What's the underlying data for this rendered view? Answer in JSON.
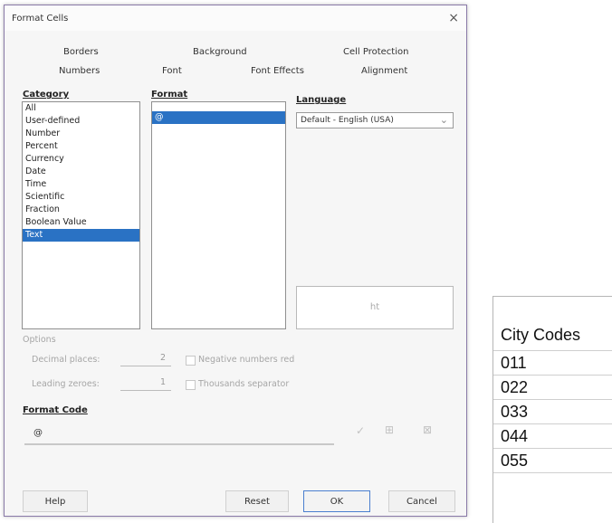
{
  "dialog": {
    "title": "Format Cells",
    "close_icon": "×",
    "tabs_top": [
      "Borders",
      "Background",
      "Cell Protection"
    ],
    "tabs_bottom": [
      "Numbers",
      "Font",
      "Font Effects",
      "Alignment"
    ],
    "category_label": "Category",
    "categories": [
      "All",
      "User-defined",
      "Number",
      "Percent",
      "Currency",
      "Date",
      "Time",
      "Scientific",
      "Fraction",
      "Boolean Value",
      "Text"
    ],
    "selected_category": "Text",
    "format_label": "Format",
    "formats": [
      "@"
    ],
    "selected_format": "@",
    "language_label": "Language",
    "language_value": "Default - English (USA)",
    "chevron_icon": "⌄",
    "preview_text": "ht",
    "options_label": "Options",
    "decimal_places_label": "Decimal places:",
    "decimal_places_value": "2",
    "leading_zeroes_label": "Leading zeroes:",
    "leading_zeroes_value": "1",
    "negative_red_label": "Negative numbers red",
    "thousands_sep_label": "Thousands separator",
    "format_code_label": "Format Code",
    "format_code_value": "@",
    "check_icon": "✓",
    "comment_icon": "⊞",
    "delete_icon": "⊠",
    "buttons": {
      "help": "Help",
      "reset": "Reset",
      "ok": "OK",
      "cancel": "Cancel"
    }
  },
  "sheet": {
    "header": "City Codes",
    "values": [
      "011",
      "022",
      "033",
      "044",
      "055"
    ]
  },
  "colors": {
    "selection": "#2a72c4",
    "ok_border": "#4a7fcf",
    "dialog_border": "#8a7aa8"
  }
}
